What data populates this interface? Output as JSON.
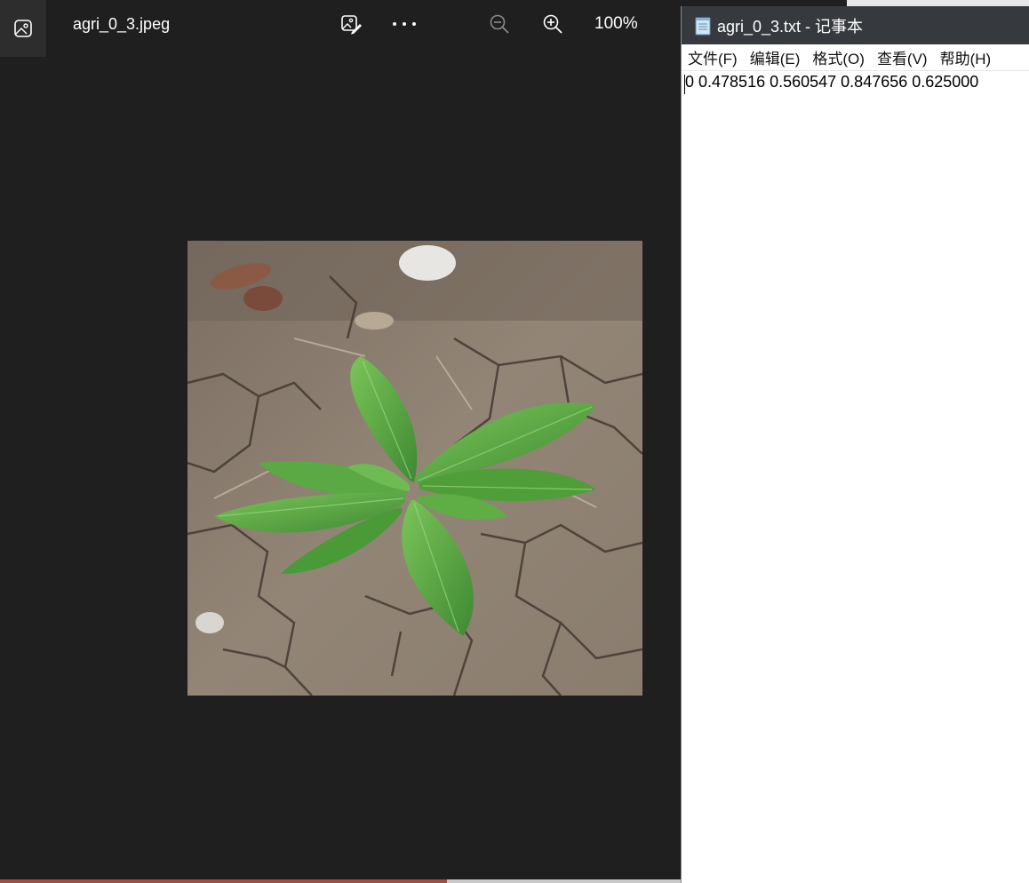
{
  "viewer": {
    "file_name": "agri_0_3.jpeg",
    "zoom_level": "100%",
    "icons": {
      "app": "photo-app-icon",
      "edit": "edit-image-icon",
      "more": "more-options-icon",
      "zoom_out": "zoom-out-icon",
      "zoom_in": "zoom-in-icon"
    },
    "photo": {
      "subject": "green seedling in cracked dry soil"
    }
  },
  "notepad": {
    "title": "agri_0_3.txt - 记事本",
    "menu": [
      "文件(F)",
      "编辑(E)",
      "格式(O)",
      "查看(V)",
      "帮助(H)"
    ],
    "content": "0 0.478516 0.560547 0.847656 0.625000"
  },
  "colors": {
    "viewer_bg": "#1f1f1f",
    "notepad_titlebar": "#363a3f",
    "leaf_green": "#5faa45",
    "soil": "#8d7f6f"
  }
}
